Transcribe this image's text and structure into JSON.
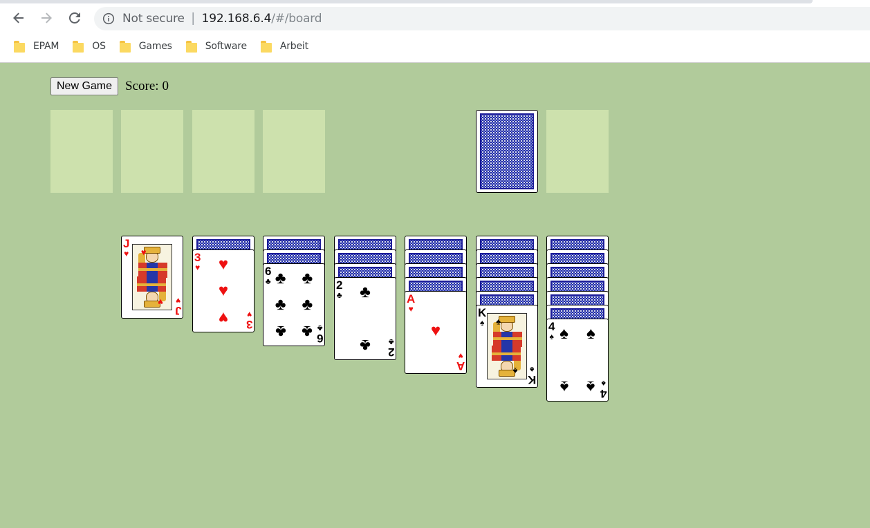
{
  "browser": {
    "security_label": "Not secure",
    "separator": "|",
    "url_host": "192.168.6.4",
    "url_path": "/#/board",
    "bookmarks": [
      {
        "label": "EPAM",
        "icon": "folder-icon"
      },
      {
        "label": "OS",
        "icon": "folder-icon"
      },
      {
        "label": "Games",
        "icon": "folder-icon"
      },
      {
        "label": "Software",
        "icon": "folder-icon"
      },
      {
        "label": "Arbeit",
        "icon": "folder-icon"
      }
    ]
  },
  "game": {
    "new_game_label": "New Game",
    "score_label": "Score:",
    "score_value": "0",
    "colors": {
      "table": "#b1cb9b",
      "empty_slot": "#cde1ad",
      "card_back": "#1f2b9c",
      "red_suit": "#ee1111"
    },
    "foundations": [
      "empty",
      "empty",
      "empty",
      "empty"
    ],
    "stock": "face-down",
    "waste": "empty",
    "tableau": [
      {
        "hidden": 0,
        "top": {
          "rank": "J",
          "suit": "♥",
          "color": "red"
        }
      },
      {
        "hidden": 1,
        "top": {
          "rank": "3",
          "suit": "♥",
          "color": "red"
        }
      },
      {
        "hidden": 2,
        "top": {
          "rank": "6",
          "suit": "♣",
          "color": "black"
        }
      },
      {
        "hidden": 3,
        "top": {
          "rank": "2",
          "suit": "♣",
          "color": "black"
        }
      },
      {
        "hidden": 4,
        "top": {
          "rank": "A",
          "suit": "♥",
          "color": "red"
        }
      },
      {
        "hidden": 5,
        "top": {
          "rank": "K",
          "suit": "♠",
          "color": "black"
        }
      },
      {
        "hidden": 6,
        "top": {
          "rank": "4",
          "suit": "♠",
          "color": "black"
        }
      }
    ]
  }
}
